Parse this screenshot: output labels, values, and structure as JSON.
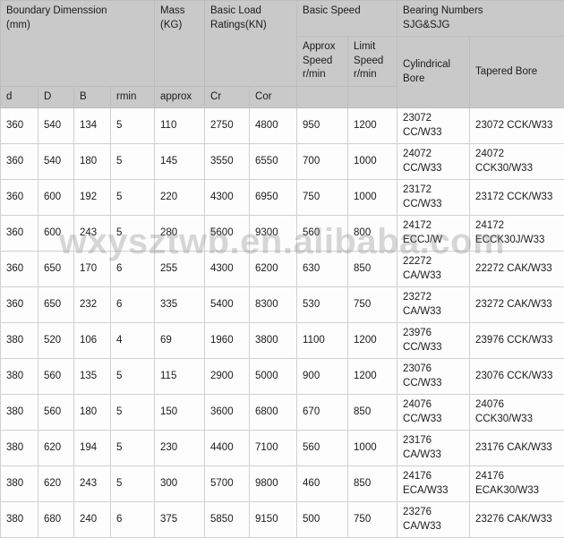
{
  "table": {
    "header": {
      "groups": [
        {
          "id": "boundary",
          "label": "Boundary Dimenssion (mm)",
          "line1": "Boundary Dimenssion",
          "line2": "(mm)"
        },
        {
          "id": "mass",
          "label": "Mass (KG)",
          "line1": "Mass",
          "line2": "(KG)"
        },
        {
          "id": "basic_load",
          "label": "Basic Load Ratings(KN)",
          "line1": "Basic Load",
          "line2": "Ratings(KN)"
        },
        {
          "id": "basic_speed",
          "label": "Basic Speed",
          "line1": "Basic Speed",
          "line2": ""
        },
        {
          "id": "bearing_numbers",
          "label": "Bearing Numbers SJG&SJG",
          "line1": "Bearing Numbers",
          "line2": "SJG&SJG"
        }
      ],
      "columns": [
        {
          "id": "d",
          "label": "d"
        },
        {
          "id": "D",
          "label": "D"
        },
        {
          "id": "B",
          "label": "B"
        },
        {
          "id": "rmin",
          "label": "rmin"
        },
        {
          "id": "approx",
          "label": "approx"
        },
        {
          "id": "cr",
          "label": "Cr"
        },
        {
          "id": "cor",
          "label": "Cor"
        },
        {
          "id": "approx_speed",
          "label": "Approx Speed r/min",
          "line1": "Approx",
          "line2": "Speed",
          "line3": "r/min"
        },
        {
          "id": "limit_speed",
          "label": "Limit Speed r/min",
          "line1": "Limit",
          "line2": "Speed",
          "line3": "r/min"
        },
        {
          "id": "cylindrical_bore",
          "label": "Cylindrical Bore"
        },
        {
          "id": "tapered_bore",
          "label": "Tapered Bore"
        }
      ]
    },
    "rows": [
      {
        "d": "360",
        "D": "540",
        "B": "134",
        "rmin": "5",
        "approx": "110",
        "cr": "2750",
        "cor": "4800",
        "approx_speed": "950",
        "limit_speed": "1200",
        "cylindrical_bore": "23072 CC/W33",
        "tapered_bore": "23072 CCK/W33"
      },
      {
        "d": "360",
        "D": "540",
        "B": "180",
        "rmin": "5",
        "approx": "145",
        "cr": "3550",
        "cor": "6550",
        "approx_speed": "700",
        "limit_speed": "1000",
        "cylindrical_bore": "24072 CC/W33",
        "tapered_bore": "24072 CCK30/W33"
      },
      {
        "d": "360",
        "D": "600",
        "B": "192",
        "rmin": "5",
        "approx": "220",
        "cr": "4300",
        "cor": "6950",
        "approx_speed": "750",
        "limit_speed": "1000",
        "cylindrical_bore": "23172 CC/W33",
        "tapered_bore": "23172 CCK/W33"
      },
      {
        "d": "360",
        "D": "600",
        "B": "243",
        "rmin": "5",
        "approx": "280",
        "cr": "5600",
        "cor": "9300",
        "approx_speed": "560",
        "limit_speed": "800",
        "cylindrical_bore": "24172 ECCJ/W",
        "tapered_bore": "24172 ECCK30J/W33"
      },
      {
        "d": "360",
        "D": "650",
        "B": "170",
        "rmin": "6",
        "approx": "255",
        "cr": "4300",
        "cor": "6200",
        "approx_speed": "630",
        "limit_speed": "850",
        "cylindrical_bore": "22272 CA/W33",
        "tapered_bore": "22272 CAK/W33"
      },
      {
        "d": "360",
        "D": "650",
        "B": "232",
        "rmin": "6",
        "approx": "335",
        "cr": "5400",
        "cor": "8300",
        "approx_speed": "530",
        "limit_speed": "750",
        "cylindrical_bore": "23272 CA/W33",
        "tapered_bore": "23272 CAK/W33"
      },
      {
        "d": "380",
        "D": "520",
        "B": "106",
        "rmin": "4",
        "approx": "69",
        "cr": "1960",
        "cor": "3800",
        "approx_speed": "1100",
        "limit_speed": "1200",
        "cylindrical_bore": "23976 CC/W33",
        "tapered_bore": "23976 CCK/W33"
      },
      {
        "d": "380",
        "D": "560",
        "B": "135",
        "rmin": "5",
        "approx": "115",
        "cr": "2900",
        "cor": "5000",
        "approx_speed": "900",
        "limit_speed": "1200",
        "cylindrical_bore": "23076 CC/W33",
        "tapered_bore": "23076 CCK/W33"
      },
      {
        "d": "380",
        "D": "560",
        "B": "180",
        "rmin": "5",
        "approx": "150",
        "cr": "3600",
        "cor": "6800",
        "approx_speed": "670",
        "limit_speed": "850",
        "cylindrical_bore": "24076 CC/W33",
        "tapered_bore": "24076 CCK30/W33"
      },
      {
        "d": "380",
        "D": "620",
        "B": "194",
        "rmin": "5",
        "approx": "230",
        "cr": "4400",
        "cor": "7100",
        "approx_speed": "560",
        "limit_speed": "1000",
        "cylindrical_bore": "23176 CA/W33",
        "tapered_bore": "23176 CAK/W33"
      },
      {
        "d": "380",
        "D": "620",
        "B": "243",
        "rmin": "5",
        "approx": "300",
        "cr": "5700",
        "cor": "9800",
        "approx_speed": "460",
        "limit_speed": "850",
        "cylindrical_bore": "24176 ECA/W33",
        "tapered_bore": "24176 ECAK30/W33"
      },
      {
        "d": "380",
        "D": "680",
        "B": "240",
        "rmin": "6",
        "approx": "375",
        "cr": "5850",
        "cor": "9150",
        "approx_speed": "500",
        "limit_speed": "750",
        "cylindrical_bore": "23276 CA/W33",
        "tapered_bore": "23276 CAK/W33"
      }
    ]
  },
  "watermark": {
    "text": "wxysztwb.en.alibaba.com"
  },
  "colors": {
    "header_background": "#c9c9c9",
    "cell_background": "#fdfdfd",
    "border": "#d0d0d0",
    "text": "#1a1a1a",
    "watermark": "#7d7d7d"
  }
}
